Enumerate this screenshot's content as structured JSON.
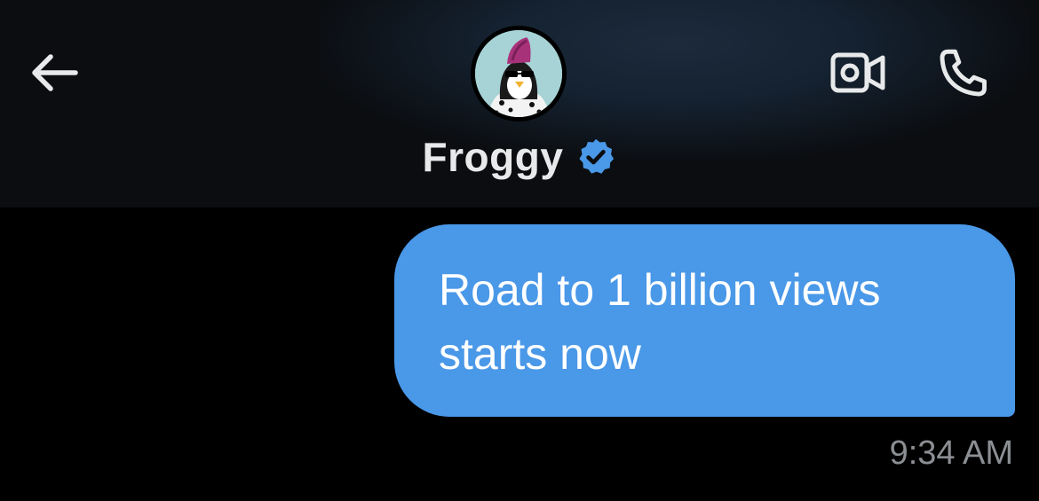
{
  "header": {
    "contact_name": "Froggy",
    "verified": true,
    "icons": {
      "back": "back-arrow-icon",
      "verified": "verified-badge-icon",
      "video": "video-camera-icon",
      "call": "phone-icon"
    }
  },
  "messages": [
    {
      "text": "Road to 1 billion views starts now",
      "sender": "me",
      "time": "9:34 AM"
    }
  ],
  "colors": {
    "bubble": "#4a98e8",
    "verified_badge": "#4a98e8",
    "name": "#e7e9ea",
    "timestamp": "#8b8f94",
    "background": "#000000"
  }
}
